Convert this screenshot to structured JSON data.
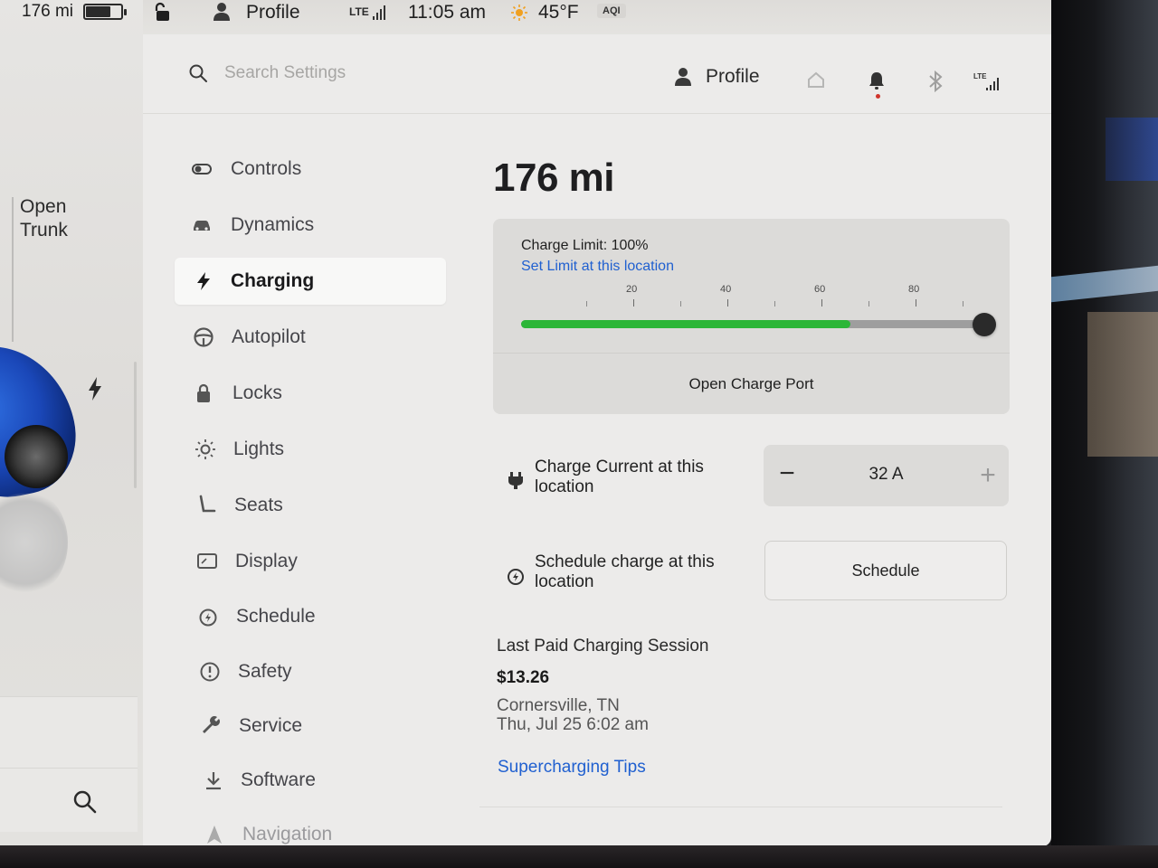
{
  "status_bar": {
    "range": "176 mi",
    "battery_level": 0.72,
    "profile_label": "Profile",
    "network": "LTE",
    "time": "11:05 am",
    "temperature": "45°F",
    "aqi_label": "AQI"
  },
  "car_panel": {
    "open_trunk_line1": "Open",
    "open_trunk_line2": "Trunk",
    "car_color": "#1a47b8"
  },
  "header": {
    "search_placeholder": "Search Settings",
    "profile_label": "Profile",
    "network": "LTE"
  },
  "nav": {
    "items": [
      {
        "label": "Controls",
        "icon": "toggle-icon"
      },
      {
        "label": "Dynamics",
        "icon": "car-icon"
      },
      {
        "label": "Charging",
        "icon": "bolt-icon",
        "active": true
      },
      {
        "label": "Autopilot",
        "icon": "steering-wheel-icon"
      },
      {
        "label": "Locks",
        "icon": "lock-icon"
      },
      {
        "label": "Lights",
        "icon": "light-icon"
      },
      {
        "label": "Seats",
        "icon": "seat-icon"
      },
      {
        "label": "Display",
        "icon": "display-icon"
      },
      {
        "label": "Schedule",
        "icon": "alarm-clock-icon"
      },
      {
        "label": "Safety",
        "icon": "alert-circle-icon"
      },
      {
        "label": "Service",
        "icon": "wrench-icon"
      },
      {
        "label": "Software",
        "icon": "download-icon"
      },
      {
        "label": "Navigation",
        "icon": "navigation-icon"
      }
    ]
  },
  "charging": {
    "range": "176 mi",
    "charge_limit_label": "Charge Limit: 100%",
    "set_limit_link": "Set Limit at this location",
    "slider_ticks": [
      "20",
      "40",
      "60",
      "80"
    ],
    "current_charge_percent": 71,
    "limit_percent": 100,
    "open_charge_port_label": "Open Charge Port",
    "charge_current_label": "Charge Current at this location",
    "charge_current_value": "32  A",
    "stepper_minus": "−",
    "stepper_plus": "+",
    "schedule_label": "Schedule charge at this location",
    "schedule_button": "Schedule",
    "last_session_title": "Last Paid Charging Session",
    "last_session_price": "$13.26",
    "last_session_location": "Cornersville, TN",
    "last_session_time": "Thu, Jul 25 6:02 am",
    "supercharging_tips": "Supercharging Tips",
    "accent_green": "#2cb638",
    "link_blue": "#2060d0"
  }
}
